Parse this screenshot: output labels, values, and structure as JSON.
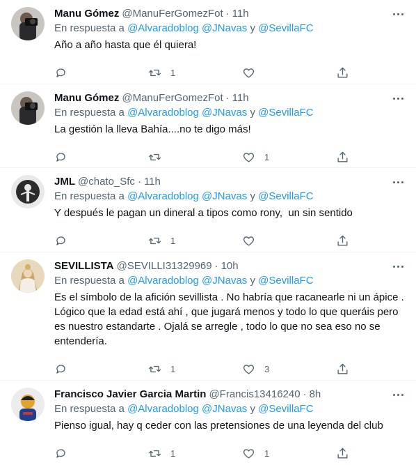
{
  "colors": {
    "accent": "#1d9bf0",
    "secondary_text": "#536471",
    "divider": "#eff3f4"
  },
  "icons": {
    "reply": "reply-icon",
    "retweet": "retweet-icon",
    "like": "like-icon",
    "share": "share-icon",
    "more": "more-icon"
  },
  "tweets": [
    {
      "name": "Manu Gómez",
      "handle": "@ManuFerGomezFot",
      "time": "11h",
      "reply_prefix": "En respuesta a",
      "mention1": "@Alvaradoblog",
      "mention2": "@JNavas",
      "conj": "y",
      "mention3": "@SevillaFC",
      "text": "Año a año hasta que él quiera!",
      "retweets": "1",
      "likes": ""
    },
    {
      "name": "Manu Gómez",
      "handle": "@ManuFerGomezFot",
      "time": "11h",
      "reply_prefix": "En respuesta a",
      "mention1": "@Alvaradoblog",
      "mention2": "@JNavas",
      "conj": "y",
      "mention3": "@SevillaFC",
      "text": "La gestión la lleva Bahía....no te digo más!",
      "retweets": "",
      "likes": "1"
    },
    {
      "name": "JML",
      "handle": "@chato_Sfc",
      "time": "11h",
      "reply_prefix": "En respuesta a",
      "mention1": "@Alvaradoblog",
      "mention2": "@JNavas",
      "conj": "y",
      "mention3": "@SevillaFC",
      "text": "Y después le pagan un dineral a tipos como rony,  un sin sentido",
      "retweets": "1",
      "likes": ""
    },
    {
      "name": "SEVILLISTA",
      "handle": "@SEVILLI31329969",
      "time": "10h",
      "reply_prefix": "En respuesta a",
      "mention1": "@Alvaradoblog",
      "mention2": "@JNavas",
      "conj": "y",
      "mention3": "@SevillaFC",
      "text": "Es el símbolo de la afición sevillista . No habría que racanearle ni un ápice . Lógico que la edad está ahí , que jugará menos y todo lo que queráis pero es nuestro estandarte . Ojalá se arregle , todo lo que no sea eso no se entendería.",
      "retweets": "1",
      "likes": "3"
    },
    {
      "name": "Francisco Javier Garcia Martin",
      "handle": "@Francis13416240",
      "time": "8h",
      "reply_prefix": "En respuesta a",
      "mention1": "@Alvaradoblog",
      "mention2": "@JNavas",
      "conj": "y",
      "mention3": "@SevillaFC",
      "text": "Pienso igual, hay q ceder con las pretensiones de una leyenda del club",
      "retweets": "1",
      "likes": "1"
    }
  ]
}
